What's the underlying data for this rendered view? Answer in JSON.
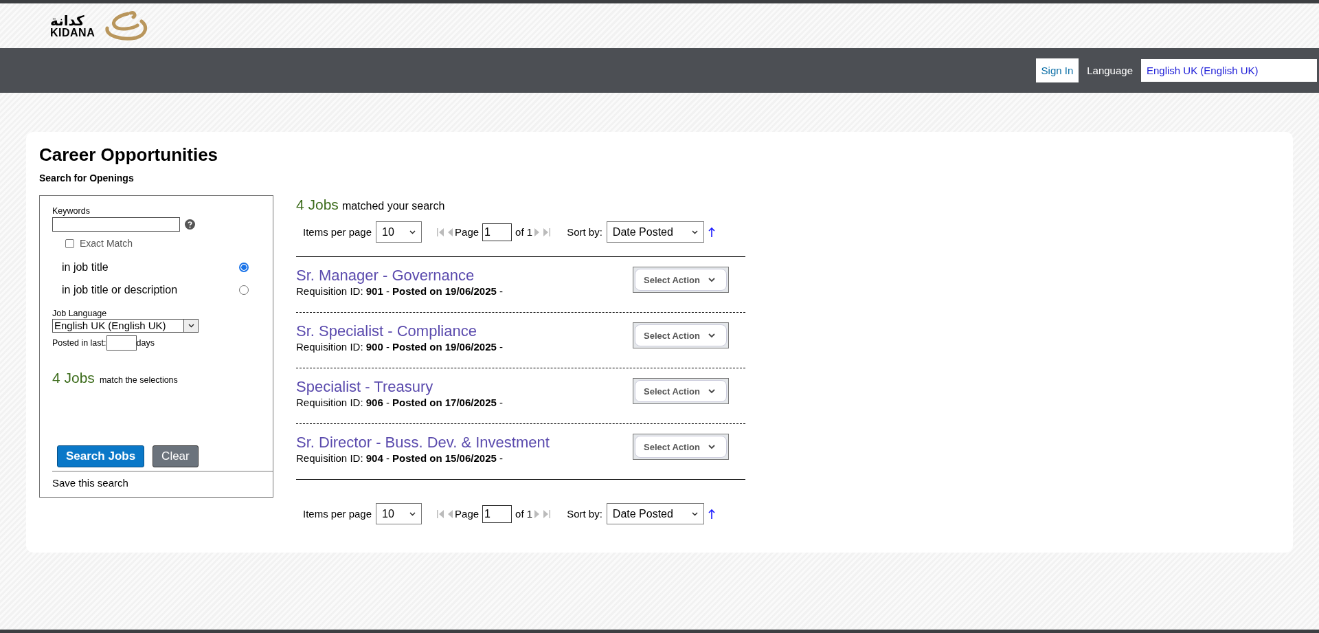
{
  "header": {
    "logo_arabic": "كدانة",
    "logo_text": "KIDANA"
  },
  "nav": {
    "sign_in": "Sign In",
    "language_label": "Language",
    "language_value": "English UK (English UK)"
  },
  "page": {
    "title": "Career Opportunities",
    "subtitle": "Search for Openings"
  },
  "search_panel": {
    "keywords_label": "Keywords",
    "exact_match": {
      "label": "Exact Match",
      "checked": false
    },
    "scopes": [
      {
        "label": "in job title",
        "selected": true
      },
      {
        "label": "in job title or description",
        "selected": false
      }
    ],
    "job_language_label": "Job Language",
    "job_language_value": "English UK (English UK)",
    "posted_label": "Posted in last:",
    "posted_unit": "days",
    "match_count": "4 Jobs",
    "match_text": "match the selections",
    "search_button": "Search Jobs",
    "clear_button": "Clear",
    "save_search": "Save this search"
  },
  "results": {
    "count": "4 Jobs",
    "count_text": "matched your search",
    "paginations": [
      {
        "items_label": "Items per page",
        "items_value": "10",
        "page_label": "Page",
        "page_value": "1",
        "of_label": "of 1",
        "sort_label": "Sort by:",
        "sort_value": "Date Posted"
      },
      {
        "items_label": "Items per page",
        "items_value": "10",
        "page_label": "Page",
        "page_value": "1",
        "of_label": "of 1",
        "sort_label": "Sort by:",
        "sort_value": "Date Posted"
      }
    ],
    "jobs": [
      {
        "title": "Sr. Manager - Governance",
        "meta": "Requisition ID: **901** - **Posted on 19/06/2025** -",
        "action": "Select Action"
      },
      {
        "title": "Sr. Specialist - Compliance",
        "meta": "Requisition ID: **900** - **Posted on 19/06/2025** -",
        "action": "Select Action"
      },
      {
        "title": "Specialist - Treasury",
        "meta": "Requisition ID: **906** - **Posted on 17/06/2025** -",
        "action": "Select Action"
      },
      {
        "title": "Sr. Director - Buss. Dev. & Investment",
        "meta": "Requisition ID: **904** - **Posted on 15/06/2025** -",
        "action": "Select Action"
      }
    ]
  }
}
